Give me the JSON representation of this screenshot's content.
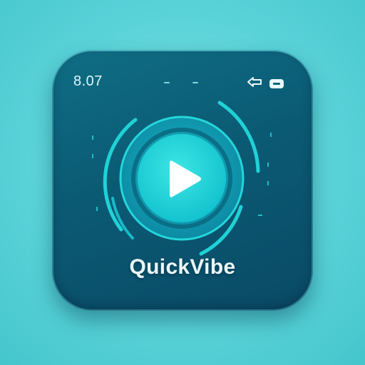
{
  "status_bar": {
    "time": "8.07"
  },
  "app": {
    "name": "QuickVibe"
  },
  "icons": {
    "play": "play-icon",
    "back": "back-arrow-icon",
    "battery": "battery-icon"
  },
  "colors": {
    "background": "#5ad3d8",
    "tile": "#0b5a74",
    "accent": "#1fd2d6",
    "accent_dark": "#0ea8b8",
    "play_glyph": "#ffffff"
  }
}
